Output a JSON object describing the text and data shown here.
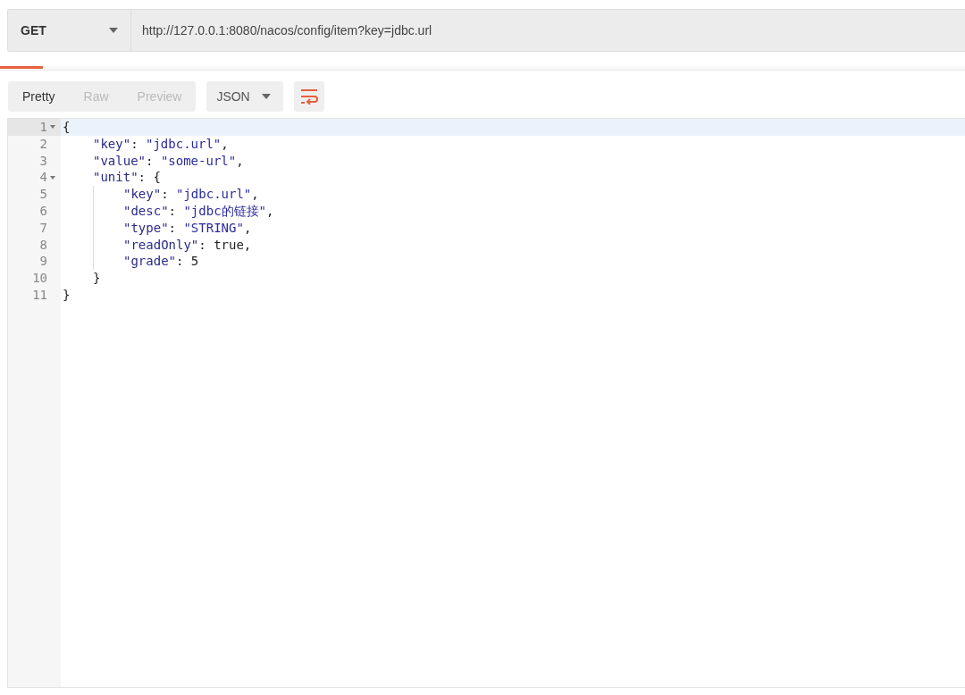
{
  "request": {
    "method": "GET",
    "url": "http://127.0.0.1:8080/nacos/config/item?key=jdbc.url"
  },
  "view_tabs": [
    {
      "label": "Pretty",
      "selected": true
    },
    {
      "label": "Raw",
      "selected": false
    },
    {
      "label": "Preview",
      "selected": false
    }
  ],
  "format": {
    "label": "JSON"
  },
  "editor": {
    "lines": [
      {
        "number": "1",
        "foldable": true,
        "active": true,
        "tokens": [
          {
            "kind": "punct",
            "text": "{"
          }
        ],
        "children": [
          {
            "number": "2",
            "foldable": false,
            "active": false,
            "tokens": [
              {
                "kind": "key",
                "text": "\"key\""
              },
              {
                "kind": "punct",
                "text": ": "
              },
              {
                "kind": "string",
                "text": "\"jdbc.url\""
              },
              {
                "kind": "punct",
                "text": ","
              }
            ]
          },
          {
            "number": "3",
            "foldable": false,
            "active": false,
            "tokens": [
              {
                "kind": "key",
                "text": "\"value\""
              },
              {
                "kind": "punct",
                "text": ": "
              },
              {
                "kind": "string",
                "text": "\"some-url\""
              },
              {
                "kind": "punct",
                "text": ","
              }
            ]
          },
          {
            "number": "4",
            "foldable": true,
            "active": false,
            "tokens": [
              {
                "kind": "key",
                "text": "\"unit\""
              },
              {
                "kind": "punct",
                "text": ": {"
              }
            ],
            "children": [
              {
                "number": "5",
                "foldable": false,
                "active": false,
                "tokens": [
                  {
                    "kind": "key",
                    "text": "\"key\""
                  },
                  {
                    "kind": "punct",
                    "text": ": "
                  },
                  {
                    "kind": "string",
                    "text": "\"jdbc.url\""
                  },
                  {
                    "kind": "punct",
                    "text": ","
                  }
                ]
              },
              {
                "number": "6",
                "foldable": false,
                "active": false,
                "tokens": [
                  {
                    "kind": "key",
                    "text": "\"desc\""
                  },
                  {
                    "kind": "punct",
                    "text": ": "
                  },
                  {
                    "kind": "string",
                    "text": "\"jdbc的链接\""
                  },
                  {
                    "kind": "punct",
                    "text": ","
                  }
                ]
              },
              {
                "number": "7",
                "foldable": false,
                "active": false,
                "tokens": [
                  {
                    "kind": "key",
                    "text": "\"type\""
                  },
                  {
                    "kind": "punct",
                    "text": ": "
                  },
                  {
                    "kind": "string",
                    "text": "\"STRING\""
                  },
                  {
                    "kind": "punct",
                    "text": ","
                  }
                ]
              },
              {
                "number": "8",
                "foldable": false,
                "active": false,
                "tokens": [
                  {
                    "kind": "key",
                    "text": "\"readOnly\""
                  },
                  {
                    "kind": "punct",
                    "text": ": true,"
                  }
                ]
              },
              {
                "number": "9",
                "foldable": false,
                "active": false,
                "tokens": [
                  {
                    "kind": "key",
                    "text": "\"grade\""
                  },
                  {
                    "kind": "punct",
                    "text": ": 5"
                  }
                ]
              }
            ]
          },
          {
            "number": "10",
            "foldable": false,
            "active": false,
            "tokens": [
              {
                "kind": "punct",
                "text": "}"
              }
            ]
          }
        ]
      },
      {
        "number": "11",
        "foldable": false,
        "active": false,
        "tokens": [
          {
            "kind": "punct",
            "text": "}"
          }
        ]
      }
    ]
  }
}
